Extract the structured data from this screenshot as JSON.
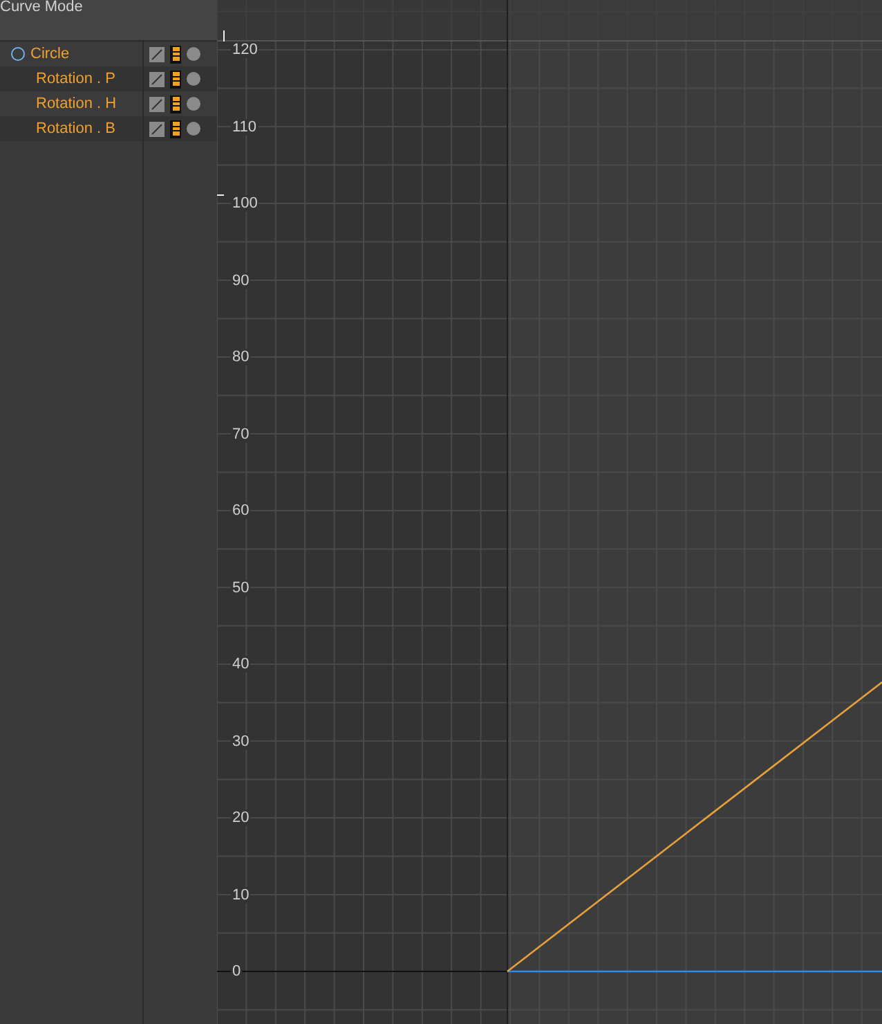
{
  "header": {
    "title": "Curve Mode"
  },
  "tracks": [
    {
      "label": "Circle",
      "kind": "object"
    },
    {
      "label": "Rotation . P",
      "kind": "track"
    },
    {
      "label": "Rotation . H",
      "kind": "track"
    },
    {
      "label": "Rotation . B",
      "kind": "track"
    }
  ],
  "graph": {
    "y_labels": [
      "120",
      "110",
      "100",
      "90",
      "80",
      "70",
      "60",
      "50",
      "40",
      "30",
      "20",
      "10",
      "0"
    ]
  }
}
